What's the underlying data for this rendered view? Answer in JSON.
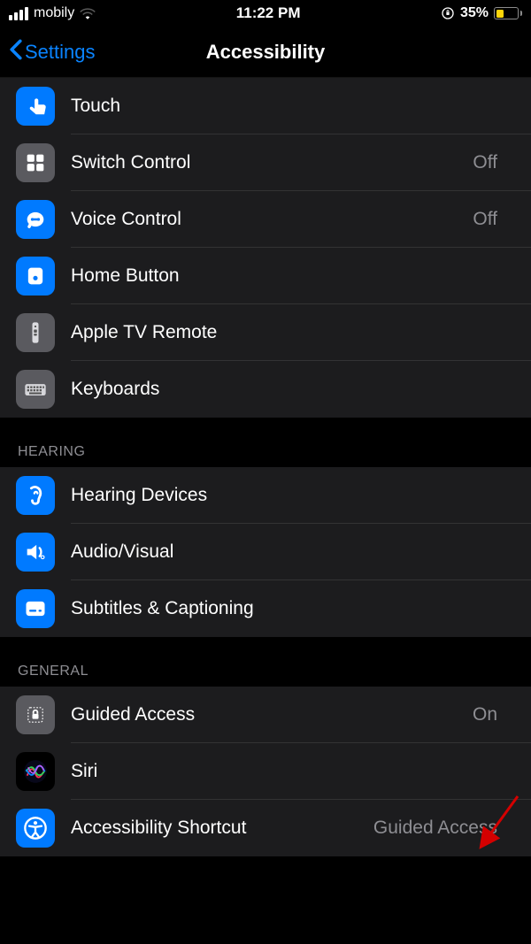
{
  "status_bar": {
    "carrier": "mobily",
    "time": "11:22 PM",
    "battery_pct_text": "35%",
    "battery_pct": 35
  },
  "nav": {
    "back_label": "Settings",
    "title": "Accessibility"
  },
  "groups": [
    {
      "header": null,
      "items": [
        {
          "key": "touch",
          "label": "Touch",
          "value": null,
          "icon_name": "touch-icon",
          "icon_class": "ic-blue",
          "svg": "touch"
        },
        {
          "key": "switch-control",
          "label": "Switch Control",
          "value": "Off",
          "icon_name": "switch-control-icon",
          "icon_class": "ic-gray",
          "svg": "grid"
        },
        {
          "key": "voice-control",
          "label": "Voice Control",
          "value": "Off",
          "icon_name": "voice-control-icon",
          "icon_class": "ic-blue",
          "svg": "voice"
        },
        {
          "key": "home-button",
          "label": "Home Button",
          "value": null,
          "icon_name": "home-button-icon",
          "icon_class": "ic-blue",
          "svg": "home"
        },
        {
          "key": "apple-tv-remote",
          "label": "Apple TV Remote",
          "value": null,
          "icon_name": "apple-tv-remote-icon",
          "icon_class": "ic-gray",
          "svg": "remote"
        },
        {
          "key": "keyboards",
          "label": "Keyboards",
          "value": null,
          "icon_name": "keyboards-icon",
          "icon_class": "ic-gray",
          "svg": "keyboard"
        }
      ]
    },
    {
      "header": "HEARING",
      "items": [
        {
          "key": "hearing-devices",
          "label": "Hearing Devices",
          "value": null,
          "icon_name": "hearing-devices-icon",
          "icon_class": "ic-blue",
          "svg": "ear"
        },
        {
          "key": "audio-visual",
          "label": "Audio/Visual",
          "value": null,
          "icon_name": "audio-visual-icon",
          "icon_class": "ic-blue",
          "svg": "audiovisual"
        },
        {
          "key": "subtitles",
          "label": "Subtitles & Captioning",
          "value": null,
          "icon_name": "subtitles-icon",
          "icon_class": "ic-blue",
          "svg": "subtitle"
        }
      ]
    },
    {
      "header": "GENERAL",
      "items": [
        {
          "key": "guided-access",
          "label": "Guided Access",
          "value": "On",
          "icon_name": "guided-access-icon",
          "icon_class": "ic-gray",
          "svg": "lock"
        },
        {
          "key": "siri",
          "label": "Siri",
          "value": null,
          "icon_name": "siri-icon",
          "icon_class": "ic-siri",
          "svg": "siri"
        },
        {
          "key": "accessibility-shortcut",
          "label": "Accessibility Shortcut",
          "value": "Guided Access",
          "icon_name": "accessibility-shortcut-icon",
          "icon_class": "ic-blue",
          "svg": "accessibility"
        }
      ]
    }
  ],
  "colors": {
    "accent": "#0a84ff",
    "row_bg": "#1c1c1e",
    "secondary_text": "#8e8e93"
  },
  "annotation": {
    "arrow_target": "accessibility-shortcut"
  }
}
